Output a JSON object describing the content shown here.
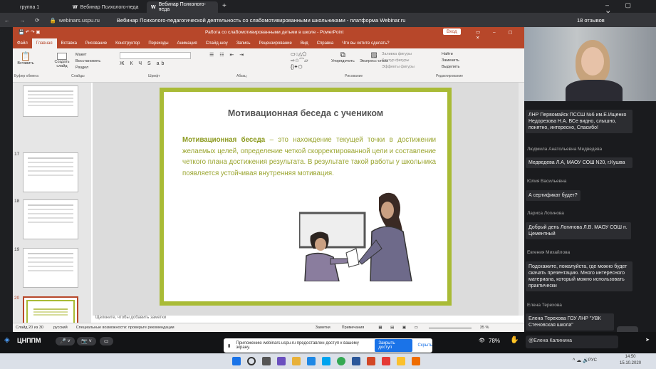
{
  "browser": {
    "tabs": [
      {
        "label": "группа 1"
      },
      {
        "label": "Вебинар Психолого-педа"
      },
      {
        "label": "Вебинар Психолого-педа"
      }
    ],
    "url": "webinars.uspu.ru",
    "page_title": "Вебинар Психолого-педагогической деятельность со слабомотивированными школьниками - платформа Webinar.ru",
    "reviews": "18 отзывов"
  },
  "ppt": {
    "title": "Работа со слабомотивированными детьми в школе - PowerPoint",
    "signin": "Вход",
    "menu": [
      "Файл",
      "Главная",
      "Вставка",
      "Рисование",
      "Конструктор",
      "Переходы",
      "Анимация",
      "Слайд-шоу",
      "Запись",
      "Рецензирование",
      "Вид",
      "Справка",
      "Что вы хотите сделать?"
    ],
    "ribbon": {
      "paste": "Вставить",
      "create_slide": "Создать слайд",
      "layout": "Макет",
      "reset": "Восстановить",
      "section": "Раздел",
      "groups": [
        "Буфер обмена",
        "Слайды",
        "Шрифт",
        "Абзац",
        "Рисование",
        "Редактирование"
      ],
      "arrange": "Упорядочить",
      "quick_styles": "Экспресс-стили",
      "fill": "Заливка фигуры",
      "outline": "Контур фигуры",
      "effects": "Эффекты фигуры",
      "find": "Найти",
      "replace": "Заменить",
      "select": "Выделить"
    },
    "thumbs": [
      "17",
      "18",
      "19",
      "20"
    ],
    "slide": {
      "title": "Мотивационная беседа с учеником",
      "term": "Мотивационная беседа",
      "text": " – это нахождение текущей точки в достижении желаемых целей, определение четкой скорректированной цели и составление четкого плана достижения результата. В результате такой работы у школьника появляется устойчивая внутренняя мотивация."
    },
    "notes": "Щелкните, чтобы добавить заметки",
    "status": {
      "slide": "Слайд 20 из 30",
      "lang": "русский",
      "accessibility": "Специальные возможности: проверьте рекомендации",
      "notes": "Заметки",
      "comments": "Примечания",
      "zoom": "35 %"
    }
  },
  "chat": [
    {
      "name": "",
      "msg": "ЛНР Первомайск ПССШ №6 им.Е.Ищенко Недорезова Н.А. ВСе видно, слышно, понятно, интересно, Спасибо!"
    },
    {
      "name": "Людмила Анатольевна Медведева",
      "msg": "Медведева Л.А, МАОУ СОШ N20, г.Кушва"
    },
    {
      "name": "Юлия Васильевна",
      "msg": "А сертификат будет?"
    },
    {
      "name": "Лариса Логинова",
      "msg": "Добрый день Логинова Л.В. МАОУ СОШ п. Цементный"
    },
    {
      "name": "Евгения Михайлова",
      "msg": "Подскажите, пожалуйста, где можно будет скачать презентацию. Много интересного материала, который можно использовать практически"
    },
    {
      "name": "Елена Терехова",
      "msg": "Елена Терехова ГОУ ЛНР \"УВК Стеновская школа\""
    }
  ],
  "bottom": {
    "logo": "ЦНППМ",
    "notice": "Приложению webinars.uspu.ru предоставлен доступ к вашему экрану.",
    "notice_stop": "Закрыть доступ",
    "notice_hide": "Скрыть",
    "viewers": "78%",
    "chat_input": "@Елена Калинина"
  },
  "taskbar": {
    "lang": "РУС",
    "time": "14:50",
    "date": "15.10.2020"
  },
  "colors": {
    "ppt_red": "#b7472a",
    "slide_green": "#a9bb36",
    "text_green": "#9aa52f"
  }
}
